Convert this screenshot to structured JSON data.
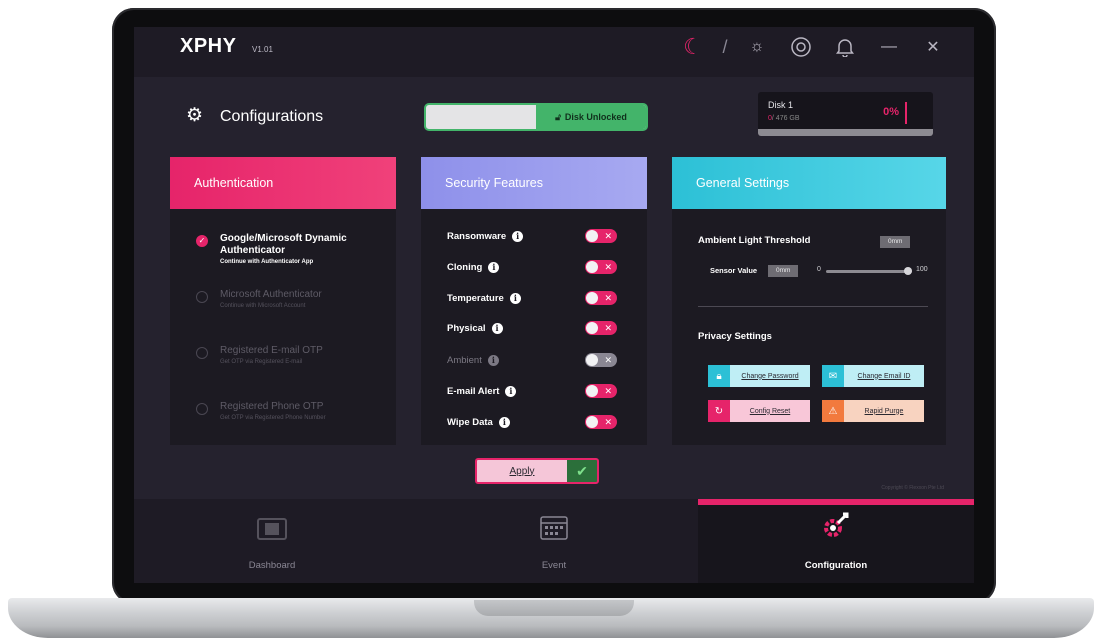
{
  "app": {
    "logo": "ΧΡΗΥ",
    "version": "V1.01"
  },
  "topbar": {
    "icons": [
      "moon-icon",
      "sun-icon",
      "support-icon",
      "bell-icon",
      "minimize-icon",
      "close-icon"
    ],
    "slash": "/"
  },
  "header": {
    "title": "Configurations",
    "disk_toggle_label": "Disk Unlocked",
    "disk": {
      "name": "Disk 1",
      "used": "0",
      "total": "/ 476 GB",
      "percent": "0%"
    }
  },
  "auth": {
    "title": "Authentication",
    "options": [
      {
        "title": "Google/Microsoft Dynamic Authenticator",
        "sub": "Continue with Authenticator App",
        "selected": true
      },
      {
        "title": "Microsoft Authenticator",
        "sub": "Continue with Microsoft Account",
        "selected": false
      },
      {
        "title": "Registered E-mail OTP",
        "sub": "Get OTP via Registered E-mail",
        "selected": false
      },
      {
        "title": "Registered Phone OTP",
        "sub": "Get OTP via Registered Phone Number",
        "selected": false
      }
    ]
  },
  "security": {
    "title": "Security Features",
    "features": [
      {
        "label": "Ransomware",
        "enabled": true
      },
      {
        "label": "Cloning",
        "enabled": true
      },
      {
        "label": "Temperature",
        "enabled": true
      },
      {
        "label": "Physical",
        "enabled": true
      },
      {
        "label": "Ambient",
        "enabled": false
      },
      {
        "label": "E-mail Alert",
        "enabled": true
      },
      {
        "label": "Wipe Data",
        "enabled": true
      }
    ]
  },
  "general": {
    "title": "General Settings",
    "ambient_label": "Ambient Light Threshold",
    "ambient_value": "0mm",
    "sensor_label": "Sensor Value",
    "sensor_value": "0mm",
    "slider_min": "0",
    "slider_max": "100",
    "slider_value": 100,
    "privacy_title": "Privacy Settings",
    "buttons": {
      "change_password": "Change Password",
      "change_email": "Change Email ID",
      "config_reset": "Config Reset",
      "rapid_purge": "Rapid Purge"
    }
  },
  "apply_label": "Apply",
  "copyright": "Copyright © Flexxon Pte Ltd",
  "nav": {
    "dashboard": "Dashboard",
    "event": "Event",
    "configuration": "Configuration"
  },
  "colors": {
    "accent": "#e6246a",
    "security": "#8e90ea",
    "general": "#2cc0d6",
    "success": "#43b46a"
  }
}
